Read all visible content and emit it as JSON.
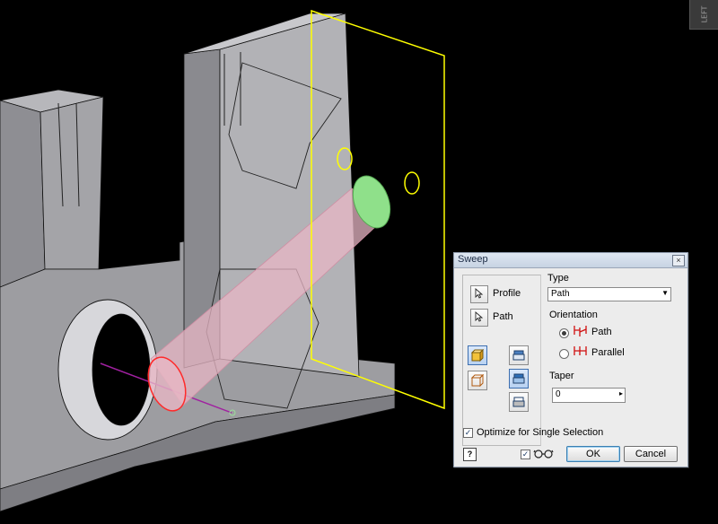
{
  "viewcube": {
    "label": "LEFT"
  },
  "dialog": {
    "title": "Sweep",
    "close_glyph": "×",
    "profile_label": "Profile",
    "path_label": "Path",
    "type_label": "Type",
    "type_value": "Path",
    "orientation_label": "Orientation",
    "orientation_options": [
      {
        "label": "Path",
        "checked": true
      },
      {
        "label": "Parallel",
        "checked": false
      }
    ],
    "taper_label": "Taper",
    "taper_value": "0",
    "optimize_label": "Optimize for Single Selection",
    "optimize_checked": true,
    "preview_checked": true,
    "ok_label": "OK",
    "cancel_label": "Cancel",
    "help_glyph": "?",
    "check_glyph": "✓"
  },
  "colors": {
    "background": "#000000",
    "part_face": "#a9a9ad",
    "plane": "#ffff00",
    "sweep_body": "#e7b6c4",
    "profile_face": "#8fe08a",
    "profile_edge": "#ff2a2a",
    "path": "#a020a0"
  },
  "icons": [
    "profile-select-icon",
    "path-select-icon",
    "solid-output-icon",
    "surface-output-icon",
    "join-icon",
    "cut-icon",
    "intersect-icon",
    "orientation-path-icon",
    "orientation-parallel-icon",
    "glasses-preview-icon",
    "help-icon"
  ]
}
